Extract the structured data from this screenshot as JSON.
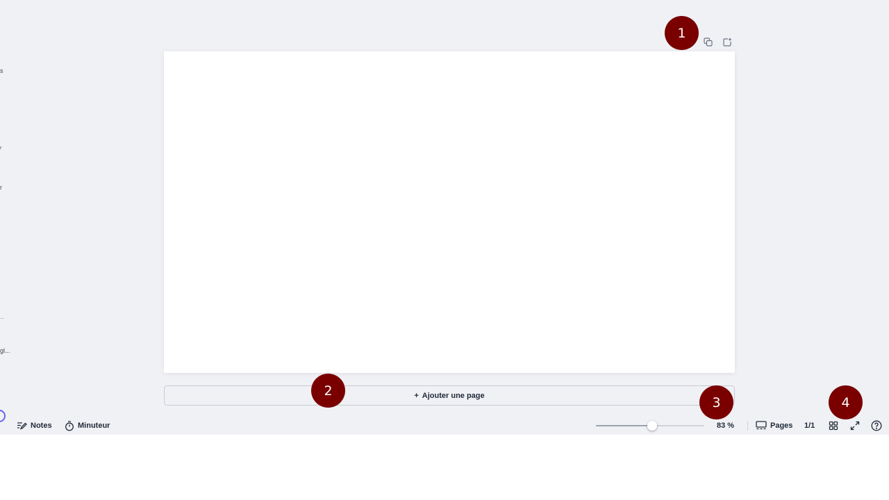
{
  "sidebar": {
    "fragments": [
      "s",
      "r",
      "r",
      "gl..."
    ]
  },
  "canvas": {
    "add_page_label": "Ajouter une page",
    "add_page_symbol": "+"
  },
  "bottombar": {
    "notes_label": "Notes",
    "timer_label": "Minuteur",
    "zoom_value": "83 %",
    "zoom_level_percent": 83,
    "pages_label": "Pages",
    "page_counter": "1/1"
  },
  "markers": [
    "1",
    "2",
    "3",
    "4"
  ],
  "colors": {
    "canvas_bg": "#f0f1f5",
    "page_bg": "#ffffff",
    "marker": "#7a0000",
    "accent": "#6366f1"
  },
  "icons": {
    "duplicate": "duplicate-page-icon",
    "add": "add-page-icon",
    "notes": "notes-icon",
    "timer": "timer-icon",
    "pages": "pages-icon",
    "grid": "grid-view-icon",
    "fullscreen": "fullscreen-icon",
    "help": "help-icon"
  }
}
